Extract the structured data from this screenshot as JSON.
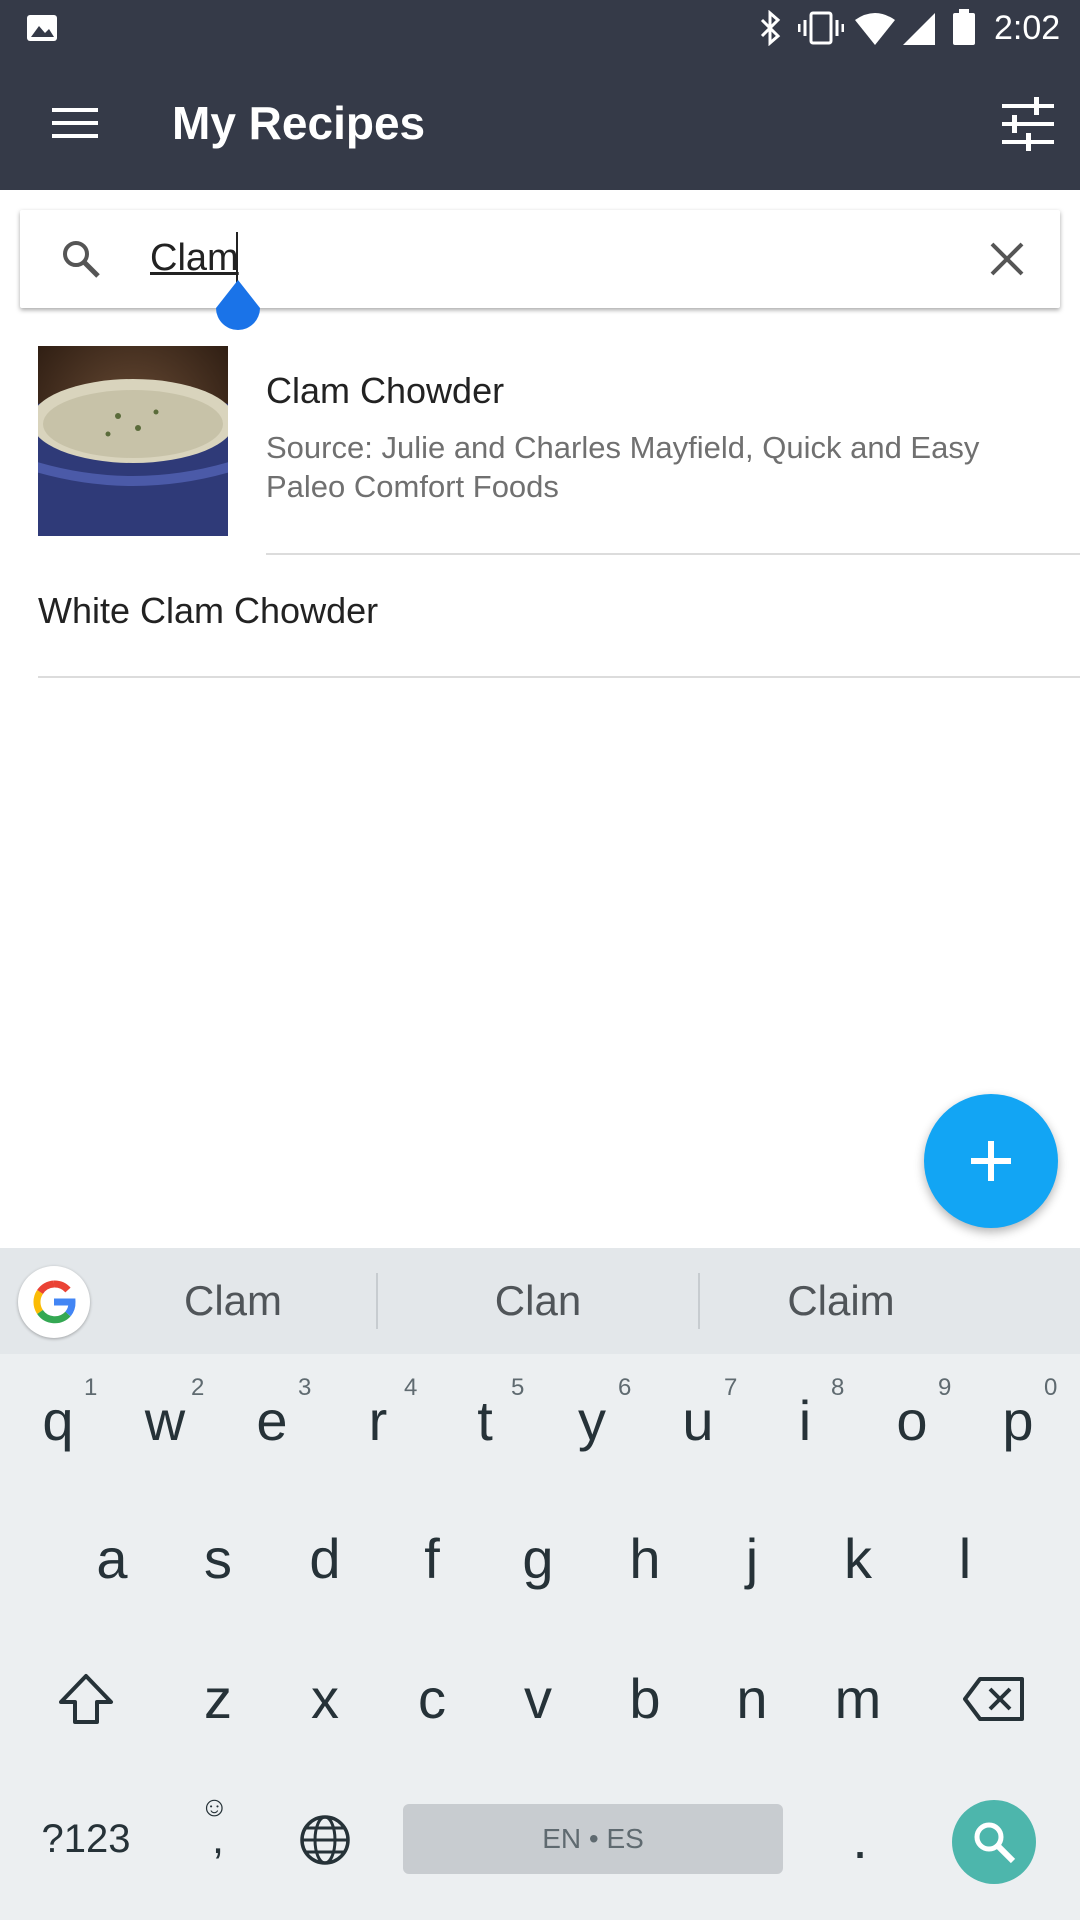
{
  "status_bar": {
    "time": "2:02",
    "icons": [
      "image-icon",
      "bluetooth-icon",
      "vibrate-icon",
      "wifi-icon",
      "cell-signal-icon",
      "battery-icon"
    ]
  },
  "app_bar": {
    "title": "My Recipes",
    "menu_icon": "menu-icon",
    "filter_icon": "tune-icon",
    "background": "#353a48"
  },
  "search": {
    "value": "Clam",
    "placeholder": ""
  },
  "results": [
    {
      "title": "Clam Chowder",
      "source": "Source: Julie and Charles Mayfield, Quick and Easy Paleo Comfort Foods",
      "has_image": true
    },
    {
      "title": "White Clam Chowder",
      "source": "",
      "has_image": false
    }
  ],
  "fab": {
    "icon": "plus-icon",
    "color": "#12a5f4"
  },
  "keyboard": {
    "suggestions": [
      "Clam",
      "Clan",
      "Claim"
    ],
    "row1": [
      "q",
      "w",
      "e",
      "r",
      "t",
      "y",
      "u",
      "i",
      "o",
      "p"
    ],
    "row1_hints": [
      "1",
      "2",
      "3",
      "4",
      "5",
      "6",
      "7",
      "8",
      "9",
      "0"
    ],
    "row2": [
      "a",
      "s",
      "d",
      "f",
      "g",
      "h",
      "j",
      "k",
      "l"
    ],
    "row3": [
      "z",
      "x",
      "c",
      "v",
      "b",
      "n",
      "m"
    ],
    "symbols_label": "?123",
    "emoji_comma": ",",
    "space_label": "EN • ES",
    "period": ".",
    "action_color": "#4db6ac"
  }
}
